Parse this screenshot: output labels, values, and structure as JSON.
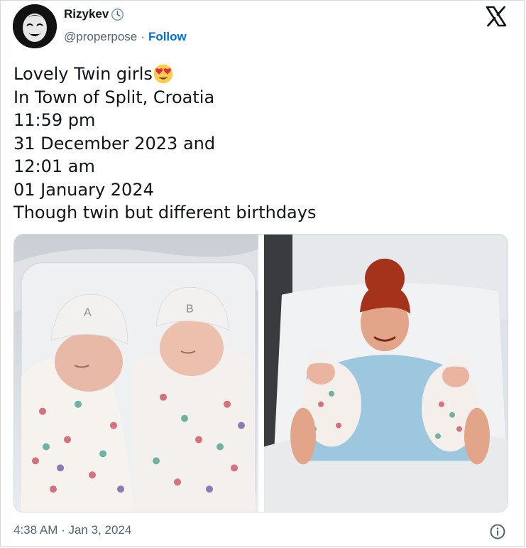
{
  "author": {
    "name": "Rizykev",
    "handle": "@properpose",
    "separator": "·",
    "follow_label": "Follow",
    "badge_icon": "clock-icon",
    "avatar_icon": "avatar-face"
  },
  "brand_icon": "x-logo-icon",
  "tweet": {
    "lines": [
      "Lovely Twin girls",
      "In Town of Split, Croatia",
      "11:59 pm",
      "31 December 2023 and",
      "12:01 am",
      "01 January 2024",
      "Though twin but different birthdays"
    ],
    "emoji": "heart-eyes-emoji"
  },
  "media": {
    "count": 2,
    "left_photo": "twin-babies-in-bassinet",
    "right_photo": "mother-holding-twins-in-hospital-bed"
  },
  "footer": {
    "timestamp": "4:38 AM · Jan 3, 2024",
    "info_icon": "info-icon"
  },
  "colors": {
    "text": "#0f1419",
    "secondary": "#536471",
    "link": "#006fd6",
    "border": "#cfd9de"
  }
}
